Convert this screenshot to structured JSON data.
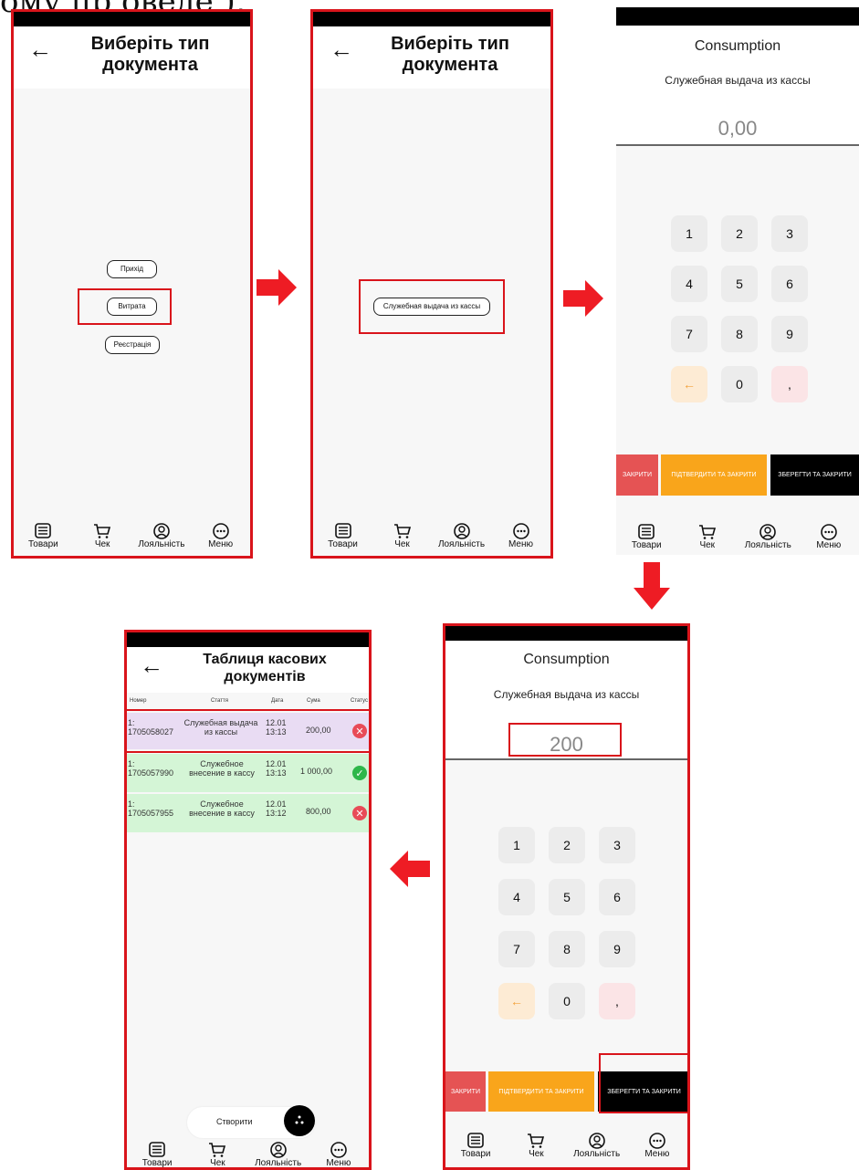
{
  "top_fragment": "ому пр оведе  ),",
  "screen1": {
    "title": "Виберіть тип документа",
    "options": [
      "Прихід",
      "Витрата",
      "Реєстрація"
    ]
  },
  "screen2": {
    "title": "Виберіть тип документа",
    "option": "Служебная выдача из кассы"
  },
  "screen3": {
    "heading": "Consumption",
    "subheading": "Служебная выдача из кассы",
    "amount": "0,00"
  },
  "screen4": {
    "heading": "Consumption",
    "subheading": "Служебная выдача из кассы",
    "amount": "200"
  },
  "keypad": {
    "keys": [
      "1",
      "2",
      "3",
      "4",
      "5",
      "6",
      "7",
      "8",
      "9",
      "←",
      "0",
      ","
    ]
  },
  "action_buttons": {
    "close": "ЗАКРИТИ",
    "confirm_close": "ПІДТВЕРДИТИ ТА ЗАКРИТИ",
    "save_close": "ЗБЕРЕГТИ ТА ЗАКРИТИ"
  },
  "nav": {
    "items": [
      "Товари",
      "Чек",
      "Лояльність",
      "Меню"
    ]
  },
  "screen5": {
    "title": "Таблиця касових документів",
    "columns": [
      "Номер",
      "Стаття",
      "Дата",
      "Сума",
      "Статус"
    ],
    "rows": [
      {
        "number": "1: 1705058027",
        "article": "Служебная выдача из кассы",
        "date": "12.01 13:13",
        "sum": "200,00",
        "status": "error"
      },
      {
        "number": "1: 1705057990",
        "article": "Служебное внесение в кассу",
        "date": "12.01 13:13",
        "sum": "1 000,00",
        "status": "ok"
      },
      {
        "number": "1: 1705057955",
        "article": "Служебное внесение в кассу",
        "date": "12.01 13:12",
        "sum": "800,00",
        "status": "error"
      }
    ],
    "create_label": "Створити"
  },
  "colors": {
    "highlight": "#d9141b",
    "arrow": "#ee1c24",
    "close_btn": "#e55354",
    "confirm_btn": "#f9a51b",
    "save_btn": "#000000",
    "row_selected": "#e9dcf3",
    "row_normal": "#d4f5d6"
  }
}
